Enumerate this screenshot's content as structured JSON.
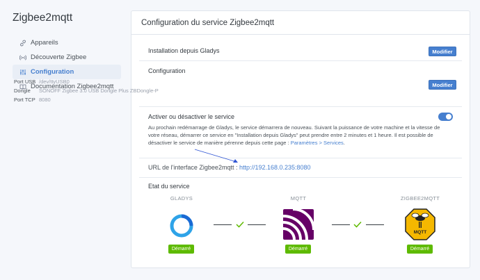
{
  "sidebar": {
    "title": "Zigbee2mqtt",
    "items": [
      {
        "label": "Appareils",
        "icon": "link-icon",
        "active": false
      },
      {
        "label": "Découverte Zigbee",
        "icon": "radio-icon",
        "active": false
      },
      {
        "label": "Configuration",
        "icon": "sliders-icon",
        "active": true
      },
      {
        "label": "Documentation Zigbee2mqtt",
        "icon": "book-icon",
        "active": false
      }
    ]
  },
  "card": {
    "title": "Configuration du service Zigbee2mqtt"
  },
  "install": {
    "title": "Installation depuis Gladys",
    "button": "Modifier"
  },
  "config": {
    "title": "Configuration",
    "button": "Modifier",
    "rows": [
      {
        "label": "Port USB",
        "value": "/dev/ttyUSB0"
      },
      {
        "label": "Dongle",
        "value": "SONOFF Zigbee 3.0 USB Dongle Plus ZBDongle-P"
      },
      {
        "label": "Port TCP",
        "value": "8080"
      }
    ]
  },
  "service_toggle": {
    "title": "Activer ou désactiver le service",
    "enabled": true,
    "description": "Au prochain redémarrage de Gladys, le service démarrera de nouveau. Suivant la puissance de votre machine et la vitesse de votre réseau, démarrer ce service en \"Installation depuis Gladys\" peut prendre entre 2 minutes et 1 heure. Il est possible de désactiver le service de manière pérenne depuis cette page : ",
    "link": "Paramètres > Services",
    "description_end": "."
  },
  "url": {
    "label": "URL de l'interface Zigbee2mqtt : ",
    "link": "http://192.168.0.235:8080"
  },
  "status": {
    "title": "Etat du service",
    "services": [
      {
        "name": "GLADYS",
        "badge": "Démarré"
      },
      {
        "name": "MQTT",
        "badge": "Démarré"
      },
      {
        "name": "ZIGBEE2MQTT",
        "badge": "Démarré"
      }
    ],
    "mqtt_logo_text": "MQTT"
  },
  "colors": {
    "primary": "#467fcf",
    "success": "#5eba00",
    "mqtt_purple": "#660066",
    "zigbee_yellow": "#f5b800"
  }
}
